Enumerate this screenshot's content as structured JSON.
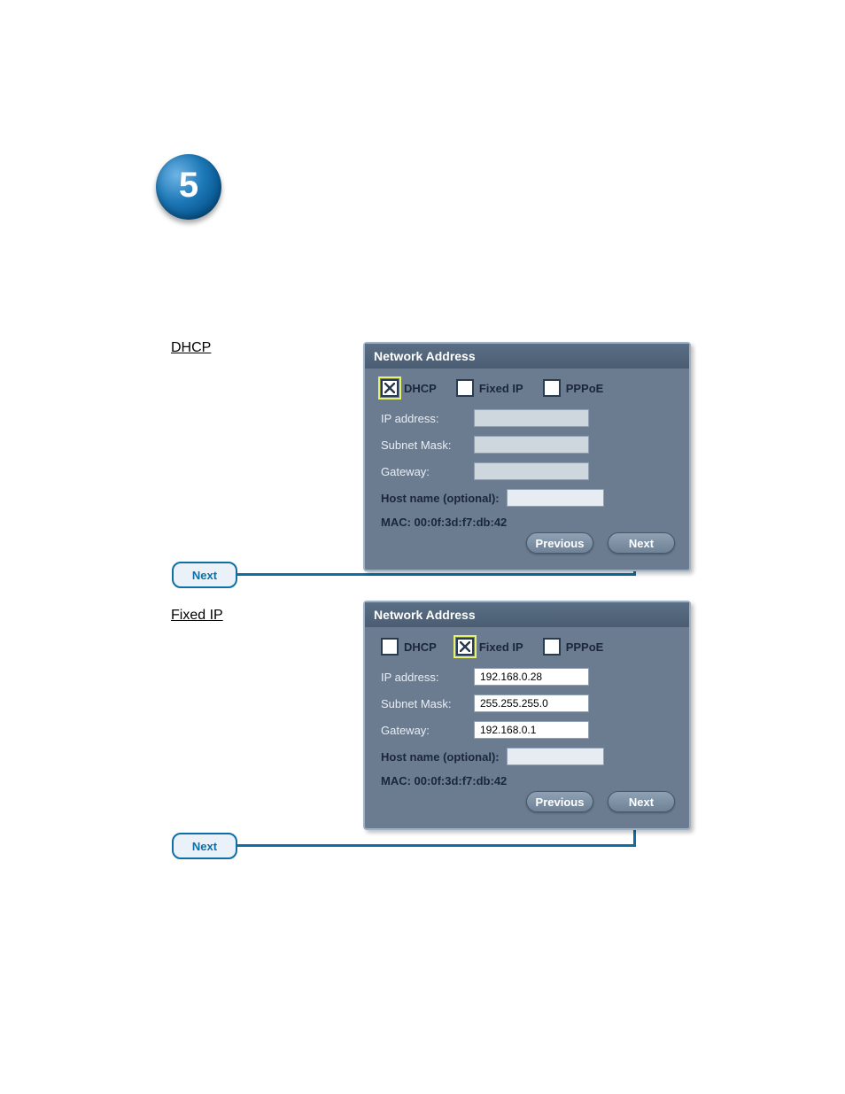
{
  "step": {
    "number": "5"
  },
  "sections": {
    "a": {
      "title": "DHCP"
    },
    "b": {
      "title": "Fixed IP"
    }
  },
  "chips": {
    "next_label": "Next"
  },
  "panels": {
    "title": "Network Address",
    "options": {
      "dhcp": "DHCP",
      "fixed": "Fixed IP",
      "pppoe": "PPPoE"
    },
    "labels": {
      "ip": "IP address:",
      "mask": "Subnet Mask:",
      "gw": "Gateway:",
      "host": "Host name (optional):",
      "mac": "MAC: 00:0f:3d:f7:db:42"
    },
    "a": {
      "selected": "dhcp",
      "ip": "",
      "mask": "",
      "gw": "",
      "host": ""
    },
    "b": {
      "selected": "fixed",
      "ip": "192.168.0.28",
      "mask": "255.255.255.0",
      "gw": "192.168.0.1",
      "host": ""
    },
    "buttons": {
      "prev": "Previous",
      "next": "Next"
    }
  }
}
